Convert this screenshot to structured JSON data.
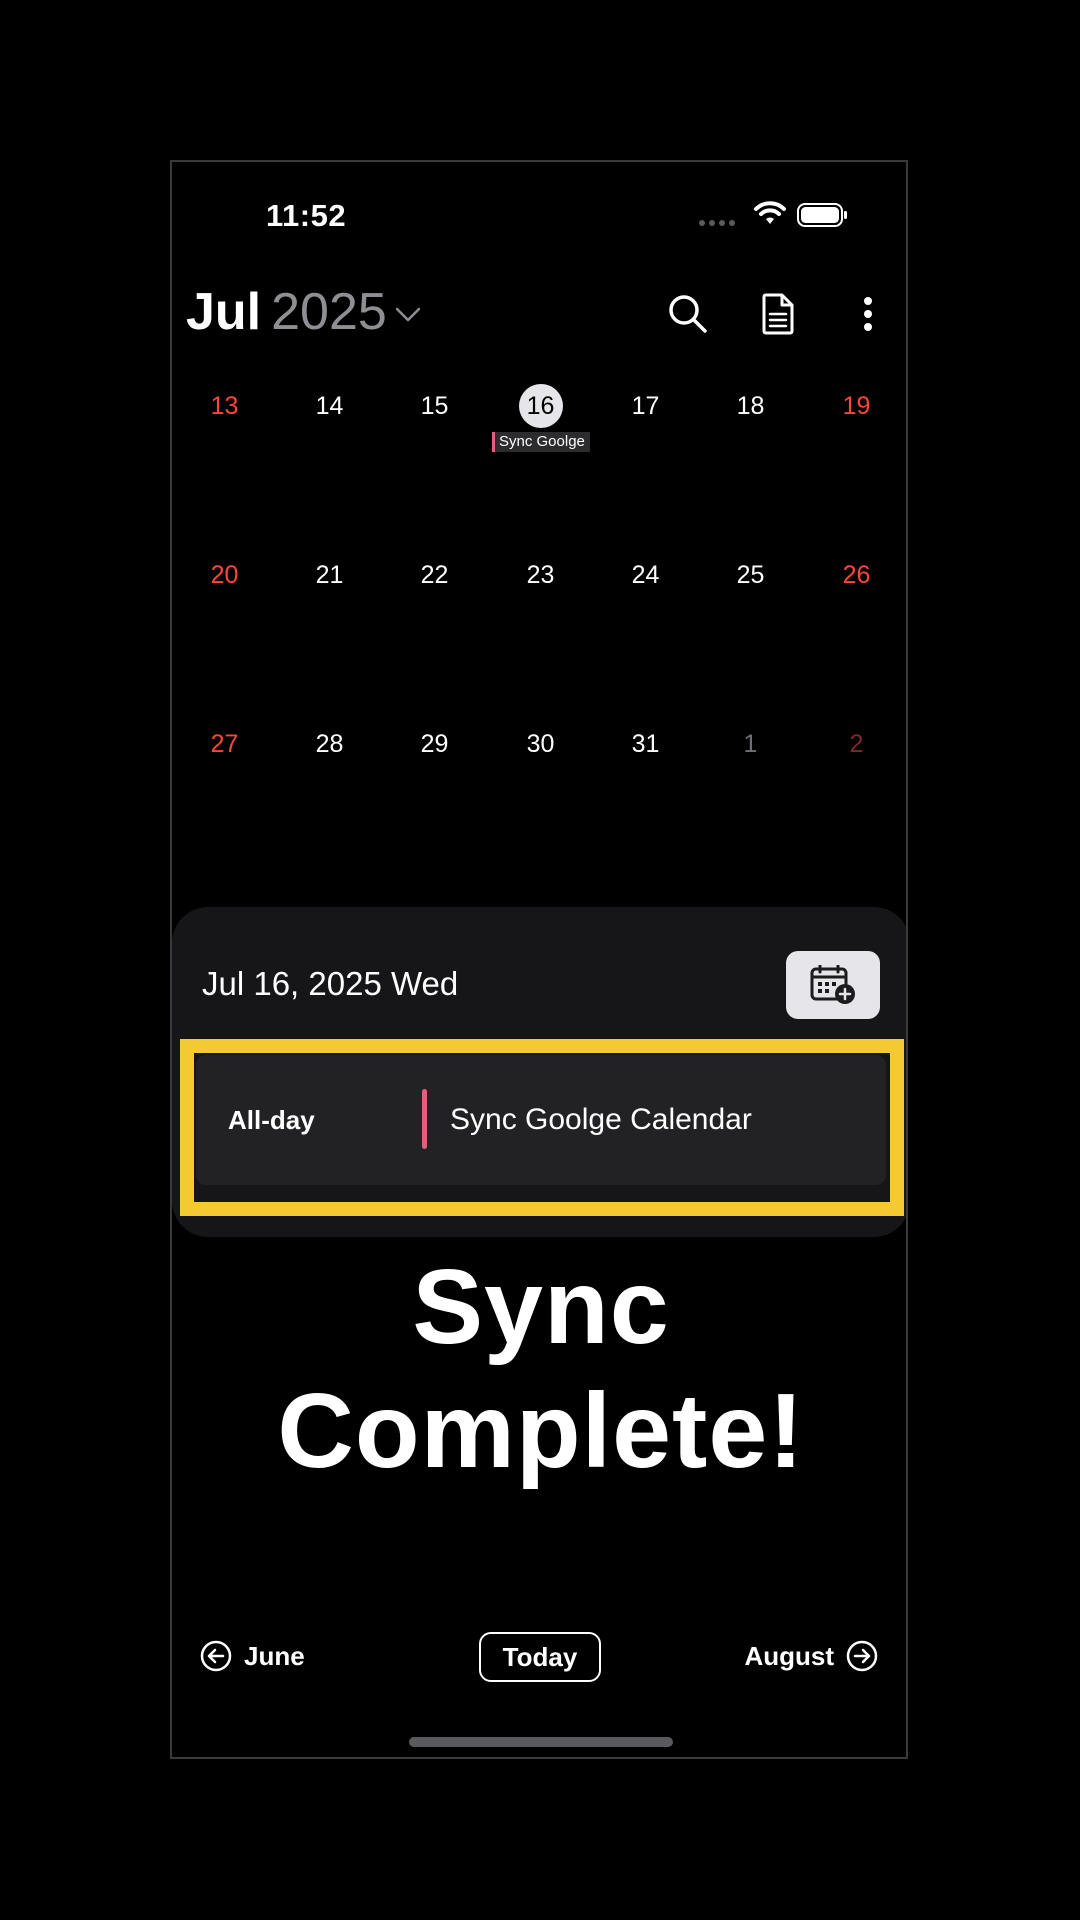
{
  "status_bar": {
    "time": "11:52"
  },
  "header": {
    "month": "Jul",
    "year": "2025",
    "search_icon": "search-icon",
    "notes_icon": "document-icon",
    "more_icon": "more-vertical-icon"
  },
  "calendar": {
    "weeks": [
      [
        {
          "day": "13",
          "weekend": true,
          "other": false
        },
        {
          "day": "14",
          "weekend": false,
          "other": false
        },
        {
          "day": "15",
          "weekend": false,
          "other": false
        },
        {
          "day": "16",
          "weekend": false,
          "other": false,
          "today": true,
          "event": "Sync Goolge"
        },
        {
          "day": "17",
          "weekend": false,
          "other": false
        },
        {
          "day": "18",
          "weekend": false,
          "other": false
        },
        {
          "day": "19",
          "weekend": true,
          "other": false
        }
      ],
      [
        {
          "day": "20",
          "weekend": true,
          "other": false
        },
        {
          "day": "21",
          "weekend": false,
          "other": false
        },
        {
          "day": "22",
          "weekend": false,
          "other": false
        },
        {
          "day": "23",
          "weekend": false,
          "other": false
        },
        {
          "day": "24",
          "weekend": false,
          "other": false
        },
        {
          "day": "25",
          "weekend": false,
          "other": false
        },
        {
          "day": "26",
          "weekend": true,
          "other": false
        }
      ],
      [
        {
          "day": "27",
          "weekend": true,
          "other": false
        },
        {
          "day": "28",
          "weekend": false,
          "other": false
        },
        {
          "day": "29",
          "weekend": false,
          "other": false
        },
        {
          "day": "30",
          "weekend": false,
          "other": false
        },
        {
          "day": "31",
          "weekend": false,
          "other": false
        },
        {
          "day": "1",
          "weekend": false,
          "other": true
        },
        {
          "day": "2",
          "weekend": true,
          "other": true
        }
      ]
    ],
    "colors": {
      "weekend": "#ff453a",
      "event": "#e0607e",
      "highlight": "#f5c932"
    }
  },
  "sheet": {
    "date_label": "Jul 16, 2025 Wed",
    "add_button_icon": "calendar-add-icon",
    "event": {
      "allday_label": "All-day",
      "title": "Sync Goolge Calendar"
    }
  },
  "overlay": {
    "line1": "Sync",
    "line2": "Complete!"
  },
  "nav": {
    "prev": "June",
    "today": "Today",
    "next": "August"
  }
}
